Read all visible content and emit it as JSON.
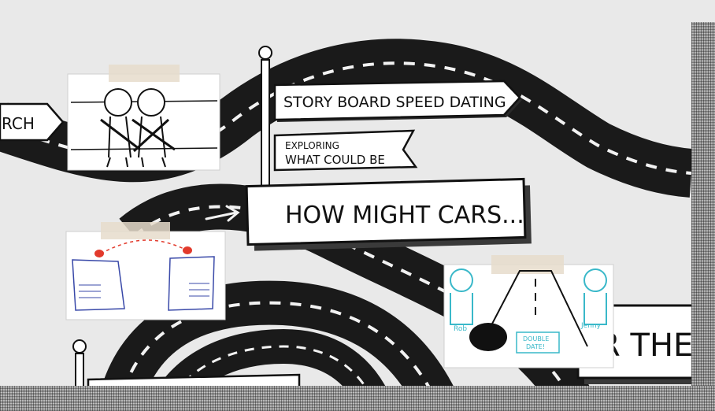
{
  "signs": {
    "left_arrow": "RCH",
    "storyboard": "STORY BOARD SPEED DATING",
    "exploring_line1": "EXPLORING",
    "exploring_line2": "WHAT COULD BE",
    "how_might": "HOW MIGHT CARS...",
    "right_partial": "R THE"
  },
  "sketch_labels": {
    "rob": "Rob",
    "jenny": "Jenny",
    "double_date_line1": "DOUBLE",
    "double_date_line2": "DATE!"
  },
  "colors": {
    "road": "#1a1a1a",
    "road_dash": "#f2f2f2",
    "sign_fill": "#ffffff",
    "sign_shadow": "#2a2a2a",
    "tape": "#e6dccb",
    "sketch_teal": "#39b8c9",
    "sketch_red": "#e23a2c",
    "sketch_blue": "#3848a8"
  }
}
